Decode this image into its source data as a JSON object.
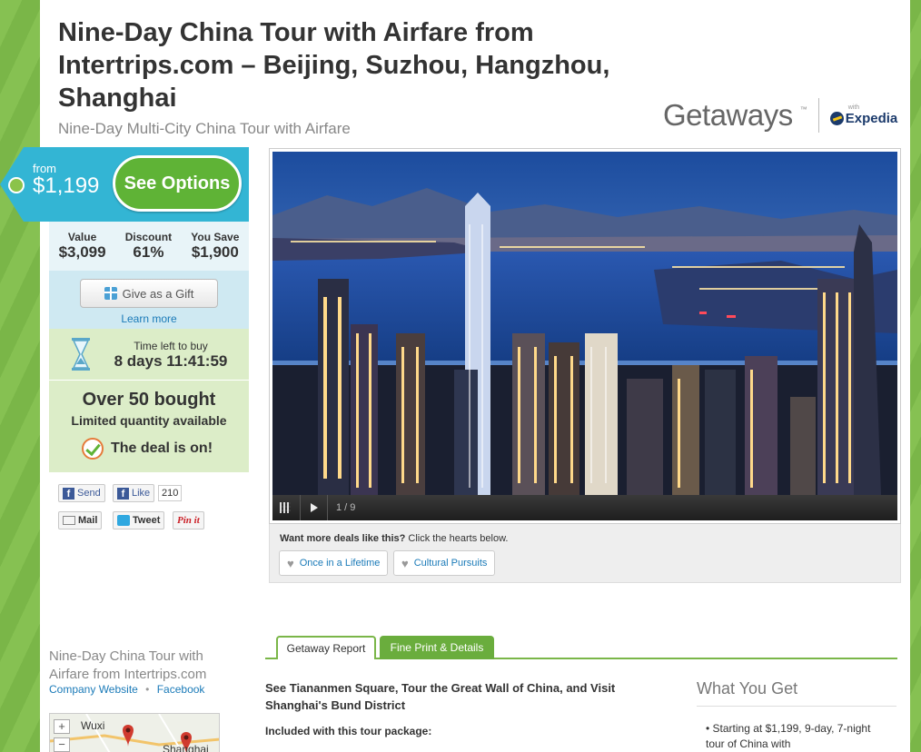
{
  "deal": {
    "title": "Nine-Day China Tour with Airfare from Intertrips.com – Beijing, Suzhou, Hangzhou, Shanghai",
    "subtitle": "Nine-Day Multi-City China Tour with Airfare"
  },
  "brand": {
    "name": "Getaways",
    "tm": "™",
    "with": "with",
    "partner": "Expedia"
  },
  "price": {
    "from_label": "from",
    "amount": "$1,199",
    "cta": "See Options",
    "accent": "#33b5d4",
    "cta_color": "#5fb336"
  },
  "stats": [
    {
      "label": "Value",
      "value": "$3,099"
    },
    {
      "label": "Discount",
      "value": "61%"
    },
    {
      "label": "You Save",
      "value": "$1,900"
    }
  ],
  "gift": {
    "button": "Give as a Gift",
    "learn_more": "Learn more"
  },
  "timer": {
    "label": "Time left to buy",
    "value": "8 days 11:41:59"
  },
  "bought": {
    "count": "Over 50 bought",
    "limit": "Limited quantity available",
    "status": "The deal is on!"
  },
  "social": {
    "send": "Send",
    "like": "Like",
    "like_count": "210",
    "mail": "Mail",
    "tweet": "Tweet",
    "pinit": "Pin it"
  },
  "gallery": {
    "counter": "1 / 9"
  },
  "wants": {
    "question": "Want more deals like this?",
    "instruction": "Click the hearts below.",
    "tags": [
      "Once in a Lifetime",
      "Cultural Pursuits"
    ]
  },
  "tabs": [
    {
      "label": "Getaway Report",
      "active": true
    },
    {
      "label": "Fine Print & Details",
      "active": false
    }
  ],
  "report": {
    "headline": "See Tiananmen Square, Tour the Great Wall of China, and Visit Shanghai's Bund District",
    "included": "Included with this tour package:"
  },
  "what_you_get": {
    "heading": "What You Get",
    "items": [
      "Starting at $1,199, 9-day, 7-night tour of China with"
    ]
  },
  "merchant": {
    "name": "Nine-Day China Tour with Airfare from Intertrips.com",
    "website": "Company Website",
    "facebook": "Facebook",
    "map_labels": [
      "Wuxi",
      "Shanghai"
    ],
    "zoom_in": "+",
    "zoom_out": "−"
  }
}
